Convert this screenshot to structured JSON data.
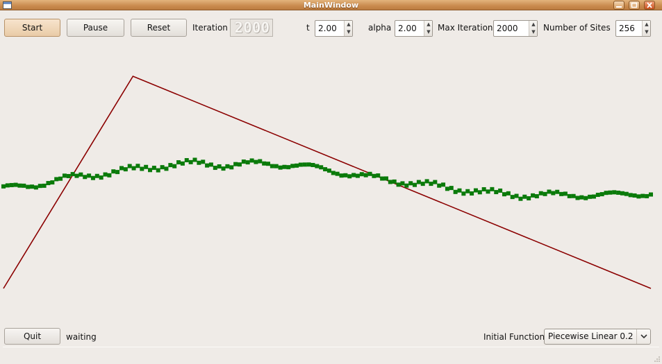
{
  "window": {
    "title": "MainWindow"
  },
  "toolbar": {
    "start_label": "Start",
    "pause_label": "Pause",
    "reset_label": "Reset",
    "iteration_label": "Iteration",
    "iteration_display": "2000",
    "t_label": "t",
    "t_value": "2.00",
    "alpha_label": "alpha",
    "alpha_value": "2.00",
    "max_iteration_label": "Max Iteration",
    "max_iteration_value": "2000",
    "sites_label": "Number of  Sites",
    "sites_value": "256"
  },
  "footer": {
    "quit_label": "Quit",
    "status_text": "waiting",
    "initial_function_label": "Initial Function",
    "initial_function_value": "Piecewise Linear 0.2"
  },
  "chart_data": {
    "type": "line",
    "xlim": [
      0,
      1
    ],
    "ylim": [
      0,
      1
    ],
    "grid": false,
    "series": [
      {
        "style": "line",
        "color": "#8b0000",
        "x": [
          0,
          0.2,
          1
        ],
        "y": [
          0,
          1,
          0
        ]
      },
      {
        "style": "scatter",
        "color": "#0a7a0a",
        "marker": "square",
        "x": [
          0.0,
          0.05,
          0.1,
          0.15,
          0.2,
          0.25,
          0.3,
          0.35,
          0.4,
          0.45,
          0.5,
          0.55,
          0.6,
          0.65,
          0.7,
          0.75,
          0.8,
          0.85,
          0.9,
          0.95,
          1.0
        ],
        "y": [
          0.47,
          0.49,
          0.52,
          0.54,
          0.56,
          0.58,
          0.59,
          0.58,
          0.59,
          0.58,
          0.56,
          0.53,
          0.51,
          0.49,
          0.47,
          0.45,
          0.44,
          0.44,
          0.44,
          0.44,
          0.45
        ]
      }
    ]
  }
}
